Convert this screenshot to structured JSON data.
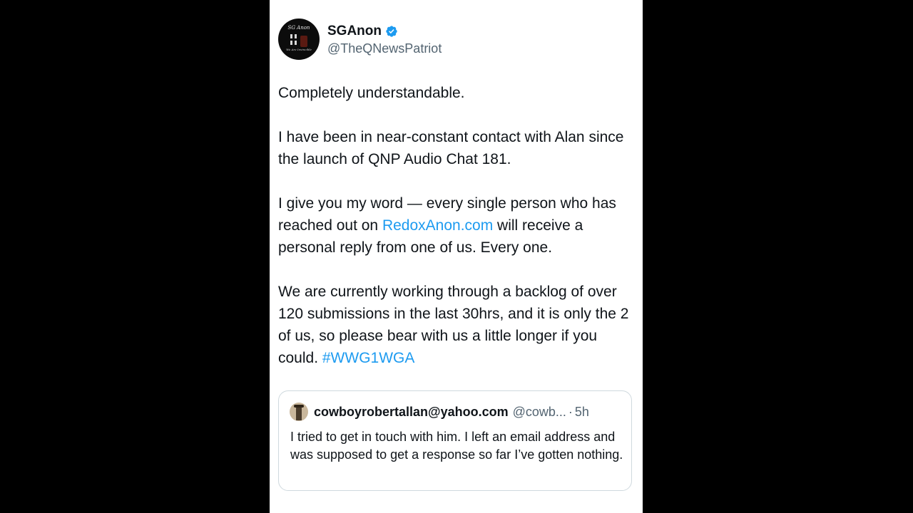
{
  "tweet": {
    "author": {
      "display_name": "SGAnon",
      "handle": "@TheQNewsPatriot",
      "verified": true,
      "avatar_title": "SG Anon",
      "avatar_subtitle": "We Are Invincible"
    },
    "paragraphs": {
      "p1": "Completely understandable.",
      "p2": "I have been in near-constant contact with Alan since the launch of QNP Audio Chat 181.",
      "p3_before": "I give you my word — every single person who has reached out on ",
      "p3_link": "RedoxAnon.com",
      "p3_after": " will receive a personal reply from one of us. Every one.",
      "p4_before": "We are currently working through a backlog of over 120 submissions in the last 30hrs, and it is only the 2 of us, so please bear with us a little longer if you could. ",
      "p4_hashtag": "#WWG1WGA"
    }
  },
  "quoted_tweet": {
    "display_name": "cowboyrobertallan@yahoo.com",
    "handle": "@cowb...",
    "separator": "·",
    "time": "5h",
    "text": "I tried to get in touch with him. I left an email address and was supposed to get a response so far I’ve gotten nothing."
  },
  "colors": {
    "background": "#000000",
    "card": "#ffffff",
    "text": "#0f1419",
    "secondary": "#536471",
    "link": "#1d9bf0",
    "verified_badge": "#1d9bf0",
    "quote_border": "#cfd9de"
  },
  "icons": {
    "verified": "verified-badge-icon"
  }
}
